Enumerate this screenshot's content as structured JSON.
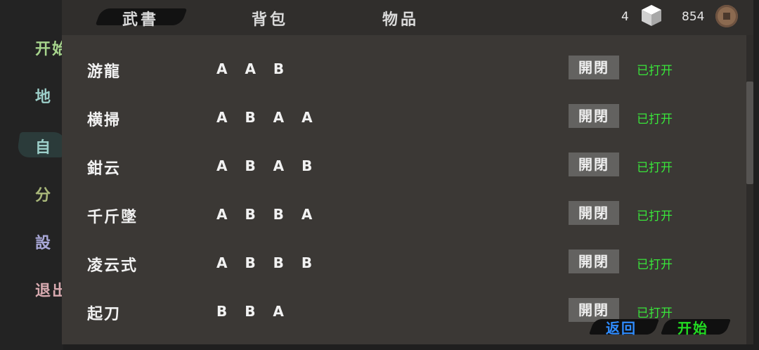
{
  "side_menu": {
    "items": [
      {
        "label": "开始",
        "color": "#a6d48c"
      },
      {
        "label": "地",
        "color": "#9ccfc9"
      },
      {
        "label": "自",
        "color": "#9ccfc9"
      },
      {
        "label": "分",
        "color": "#a9b87a"
      },
      {
        "label": "設",
        "color": "#a9a8d8"
      },
      {
        "label": "退出",
        "color": "#d8aab0"
      }
    ]
  },
  "tabs": [
    {
      "label": "武書",
      "active": true
    },
    {
      "label": "背包",
      "active": false
    },
    {
      "label": "物品",
      "active": false
    }
  ],
  "currency": {
    "cube_count": "4",
    "coin_count": "854"
  },
  "skills": [
    {
      "name": "游龍",
      "combo": "A A B",
      "button": "開閉",
      "status": "已打开"
    },
    {
      "name": "横掃",
      "combo": "A B A A",
      "button": "開閉",
      "status": "已打开"
    },
    {
      "name": "鉗云",
      "combo": "A B A B",
      "button": "開閉",
      "status": "已打开"
    },
    {
      "name": "千斤墜",
      "combo": "A B B A",
      "button": "開閉",
      "status": "已打开"
    },
    {
      "name": "凌云式",
      "combo": "A B B B",
      "button": "開閉",
      "status": "已打开"
    },
    {
      "name": "起刀",
      "combo": "B B A",
      "button": "開閉",
      "status": "已打开"
    }
  ],
  "bottom": {
    "back_label": "返回",
    "start_label": "开始",
    "back_color": "#2f8cff",
    "start_color": "#22dd22"
  },
  "colors": {
    "status_green": "#39e53a",
    "panel_bg": "#3b3835"
  }
}
